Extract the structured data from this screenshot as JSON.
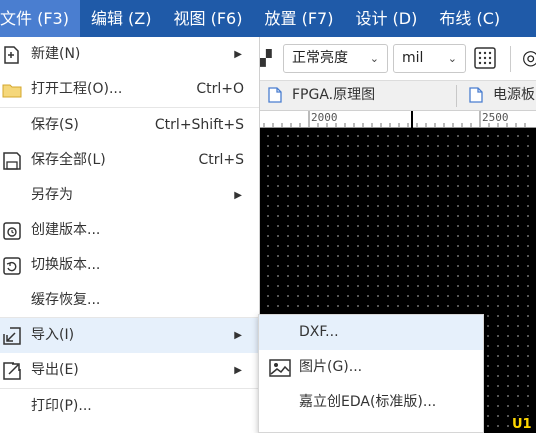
{
  "menubar": {
    "items": [
      {
        "label": "文件 (F3)"
      },
      {
        "label": "编辑 (Z)"
      },
      {
        "label": "视图 (F6)"
      },
      {
        "label": "放置 (F7)"
      },
      {
        "label": "设计 (D)"
      },
      {
        "label": "布线 (C)"
      }
    ],
    "colors": {
      "background": "#1f5aa8",
      "active": "#4a7ed0",
      "text": "#ffffff"
    }
  },
  "toolbar": {
    "brightness_select": "正常亮度",
    "unit_select": "mil"
  },
  "tabs": [
    {
      "label": "FPGA.原理图"
    },
    {
      "label": "电源板"
    }
  ],
  "ruler": {
    "labels": [
      "2000",
      "2500"
    ]
  },
  "canvas": {
    "designator": "U1",
    "background": "#000000"
  },
  "file_menu": {
    "items": [
      {
        "label": "新建(N)",
        "icon": "new-file-icon",
        "submenu": true
      },
      {
        "label": "打开工程(O)...",
        "shortcut": "Ctrl+O",
        "icon": "folder-icon"
      },
      {
        "label": "保存(S)",
        "shortcut": "Ctrl+Shift+S"
      },
      {
        "label": "保存全部(L)",
        "shortcut": "Ctrl+S",
        "icon": "save-all-icon"
      },
      {
        "label": "另存为",
        "submenu": true
      },
      {
        "label": "创建版本...",
        "icon": "create-version-icon"
      },
      {
        "label": "切换版本...",
        "icon": "switch-version-icon"
      },
      {
        "label": "缓存恢复..."
      },
      {
        "label": "导入(I)",
        "icon": "import-icon",
        "submenu": true,
        "highlighted": true
      },
      {
        "label": "导出(E)",
        "icon": "export-icon",
        "submenu": true
      },
      {
        "label": "打印(P)..."
      }
    ],
    "highlight_color": "#e6f0fb"
  },
  "import_submenu": {
    "items": [
      {
        "label": "DXF...",
        "highlighted": true
      },
      {
        "label": "图片(G)...",
        "icon": "image-icon"
      },
      {
        "label": "嘉立创EDA(标准版)..."
      }
    ]
  }
}
